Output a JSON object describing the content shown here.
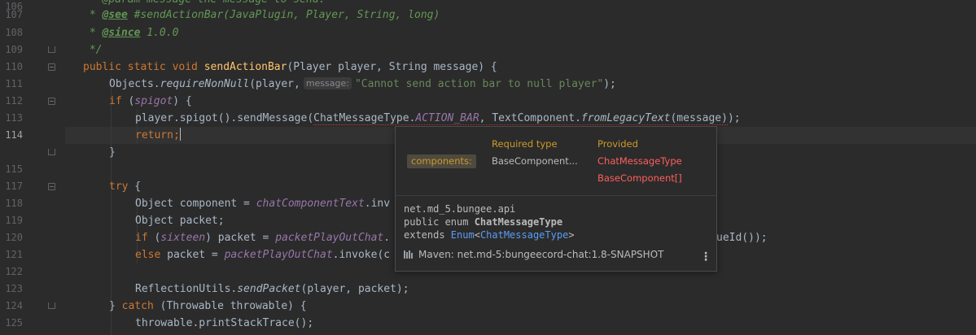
{
  "editor": {
    "current_line": "114",
    "line_numbers": [
      "106",
      "107",
      "108",
      "109",
      "110",
      "111",
      "112",
      "113",
      "114",
      "115",
      "117",
      "118",
      "119",
      "120",
      "121",
      "122",
      "123",
      "124",
      "125"
    ],
    "lines": {
      "l106_text": " * @param message the message to send.",
      "l107_star": " * ",
      "l107_tag": "@see",
      "l107_ref": " #sendActionBar(JavaPlugin, Player, String, long)",
      "l108_star": " * ",
      "l108_tag": "@since",
      "l108_ver": " 1.0.0",
      "l109": " */",
      "l110_mod": "public static void ",
      "l110_name": "sendActionBar",
      "l110_rest": "(Player player, String message) {",
      "l111_a": "Objects.",
      "l111_b": "requireNonNull",
      "l111_c": "(player,",
      "l111_hint": "message:",
      "l111_str": "\"Cannot send action bar to null player\"",
      "l111_end": ");",
      "l112_kw": "if ",
      "l112_paren": "(",
      "l112_fld": "spigot",
      "l112_end": ") {",
      "l113_a": "player.spigot().sendMessage(",
      "l113_b": "ChatMessageType.",
      "l113_c": "ACTION_BAR",
      "l113_d": ", TextComponent.",
      "l113_e": "fromLegacyText",
      "l113_f": "(message)",
      "l113_g": ");",
      "l114_kw": "return",
      "l114_semi": ";",
      "l116_close": "}",
      "l117_kw": "try",
      "l117_brace": " {",
      "l118_a": "Object component = ",
      "l118_fld": "chatComponentText",
      "l118_b": ".inv",
      "l119": "Object packet;",
      "l120_kw": "if ",
      "l120_p": "(",
      "l120_fld1": "sixteen",
      "l120_b": ") packet = ",
      "l120_fld2": "packetPlayOutChat",
      "l120_c": ".",
      "l120_tail": "ueId());",
      "l121_kw": "else ",
      "l121_b": "packet = ",
      "l121_fld": "packetPlayOutChat",
      "l121_c": ".invoke(c",
      "l123_a": "ReflectionUtils.",
      "l123_b": "sendPacket",
      "l123_c": "(player, packet);",
      "l124_a": "} ",
      "l124_kw": "catch ",
      "l124_b": "(Throwable throwable) {",
      "l125": "throwable.printStackTrace();"
    }
  },
  "popup": {
    "header_required": "Required type",
    "header_provided": "Provided",
    "param_label": "components:",
    "required_type": "BaseComponent...",
    "provided_types": [
      "ChatMessageType",
      "BaseComponent[]"
    ],
    "doc_package": "net.md_5.bungee.api",
    "doc_decl_prefix": "public enum ",
    "doc_decl_name": "ChatMessageType",
    "doc_extends_prefix": "extends ",
    "doc_extends_enum": "Enum",
    "doc_extends_lt": "<",
    "doc_extends_param": "ChatMessageType",
    "doc_extends_gt": ">",
    "maven_text": "Maven: net.md-5:bungeecord-chat:1.8-SNAPSHOT",
    "more_label": "⋮"
  },
  "colors": {
    "background": "#2b2b2b",
    "current_line": "#323232",
    "keyword": "#cc7832",
    "method_decl": "#ffc66d",
    "string": "#6a8759",
    "field": "#9876aa",
    "doc_comment": "#629755",
    "error": "#ff5f5f",
    "popup_header": "#cd9a28",
    "link": "#589df6"
  }
}
